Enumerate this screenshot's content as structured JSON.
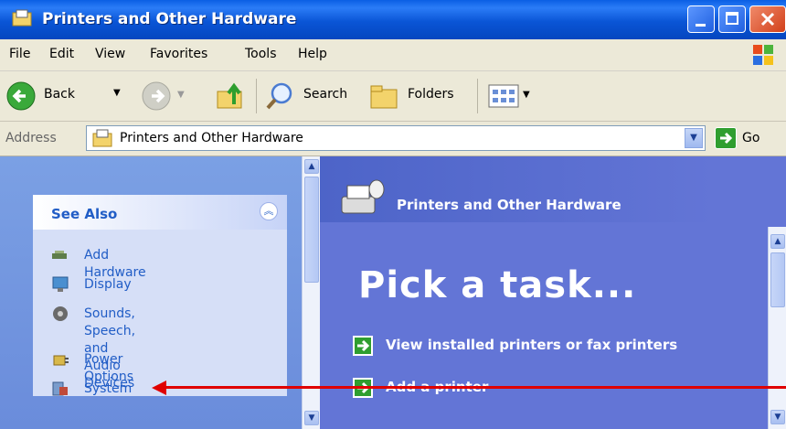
{
  "window": {
    "title": "Printers and Other Hardware"
  },
  "menu": [
    "File",
    "Edit",
    "View",
    "Favorites",
    "Tools",
    "Help"
  ],
  "toolbar": {
    "back_label": "Back",
    "search_label": "Search",
    "folders_label": "Folders"
  },
  "address": {
    "label": "Address",
    "value": "Printers and Other Hardware",
    "go_label": "Go"
  },
  "see_also": {
    "title": "See Also",
    "items": [
      {
        "label": "Add Hardware",
        "icon": "add-hardware-icon"
      },
      {
        "label": "Display",
        "icon": "display-icon"
      },
      {
        "label": "Sounds, Speech, and\nAudio Devices",
        "icon": "speaker-icon"
      },
      {
        "label": "Power Options",
        "icon": "power-options-icon"
      },
      {
        "label": "System",
        "icon": "system-icon"
      }
    ]
  },
  "main": {
    "header_title": "Printers and Other Hardware",
    "heading": "Pick a task...",
    "tasks": [
      {
        "label": "View installed printers or fax printers"
      },
      {
        "label": "Add a printer"
      }
    ]
  },
  "colors": {
    "titlebar": "#0a55d6",
    "left_pane": "#7ba0e4",
    "right_pane": "#6375d6",
    "link": "#215dc6",
    "annotation_arrow": "#e00000"
  }
}
